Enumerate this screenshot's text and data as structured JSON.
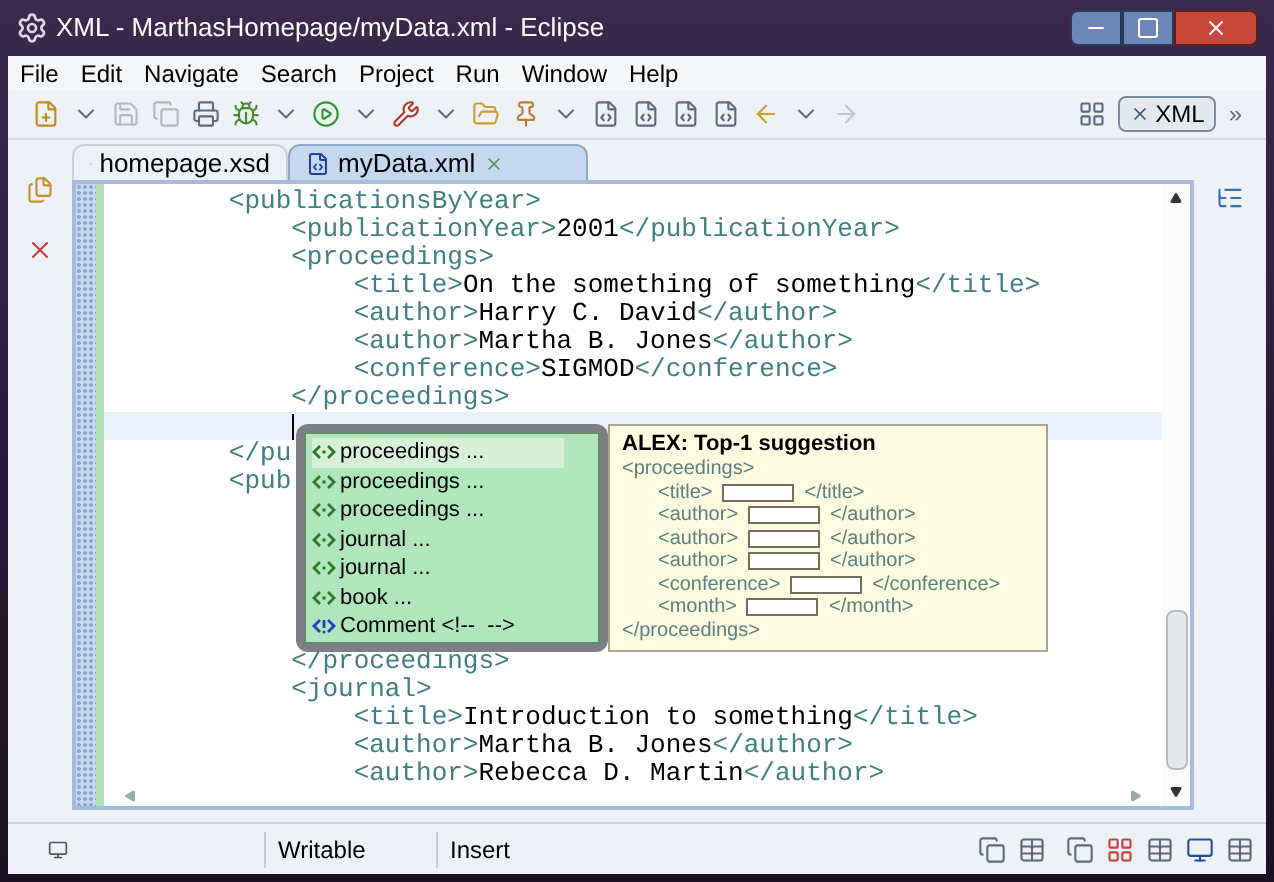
{
  "window": {
    "title": "XML - MarthasHomepage/myData.xml - Eclipse"
  },
  "menu": [
    "File",
    "Edit",
    "Navigate",
    "Search",
    "Project",
    "Run",
    "Window",
    "Help"
  ],
  "toolbar": {
    "perspective": "XML",
    "more": "»"
  },
  "tabs": [
    {
      "label": "homepage.xsd",
      "selected": false
    },
    {
      "label": "myData.xml",
      "selected": true
    }
  ],
  "editor": {
    "lines_above": [
      {
        "kind": "code",
        "open": "        <publicationsByYear>"
      },
      {
        "kind": "code",
        "open": "            <publicationYear>",
        "content": "2001",
        "close": "</publicationYear>"
      },
      {
        "kind": "code",
        "open": "            <proceedings>"
      },
      {
        "kind": "code",
        "open": "                <title>",
        "content": "On the something of something",
        "close": "</title>"
      },
      {
        "kind": "code",
        "open": "                <author>",
        "content": "Harry C. David",
        "close": "</author>"
      },
      {
        "kind": "code",
        "open": "                <author>",
        "content": "Martha B. Jones",
        "close": "</author>"
      },
      {
        "kind": "code",
        "open": "                <conference>",
        "content": "SIGMOD",
        "close": "</conference>"
      },
      {
        "kind": "code",
        "open": "            </proceedings>"
      },
      {
        "kind": "caret"
      }
    ],
    "partial_lines": [
      "        </pu",
      "        <pub"
    ],
    "lines_below": [
      {
        "kind": "code",
        "open": "            </proceedings>"
      },
      {
        "kind": "code",
        "open": "            <journal>"
      },
      {
        "kind": "code",
        "open": "                <title>",
        "content": "Introduction to something",
        "close": "</title>"
      },
      {
        "kind": "code",
        "open": "                <author>",
        "content": "Martha B. Jones",
        "close": "</author>"
      },
      {
        "kind": "code",
        "open": "                <author>",
        "content": "Rebecca D. Martin",
        "close": "</author>"
      }
    ]
  },
  "completion": {
    "items": [
      {
        "kind": "element",
        "label": "proceedings ...",
        "selected": true
      },
      {
        "kind": "element",
        "label": "proceedings ...",
        "selected": false
      },
      {
        "kind": "element",
        "label": "proceedings ...",
        "selected": false
      },
      {
        "kind": "element",
        "label": "journal ...",
        "selected": false
      },
      {
        "kind": "element",
        "label": "journal ...",
        "selected": false
      },
      {
        "kind": "element",
        "label": "book ...",
        "selected": false
      },
      {
        "kind": "comment",
        "label": "Comment <!--  -->",
        "selected": false
      }
    ]
  },
  "suggestion": {
    "title": "ALEX: Top-1 suggestion",
    "open": "<proceedings>",
    "fields": [
      {
        "open": "<title>",
        "close": "</title>"
      },
      {
        "open": "<author>",
        "close": "</author>"
      },
      {
        "open": "<author>",
        "close": "</author>"
      },
      {
        "open": "<author>",
        "close": "</author>"
      },
      {
        "open": "<conference>",
        "close": "</conference>"
      },
      {
        "open": "<month>",
        "close": "</month>"
      }
    ],
    "close": "</proceedings>"
  },
  "status_bar": {
    "access": "Writable",
    "mode": "Insert"
  }
}
